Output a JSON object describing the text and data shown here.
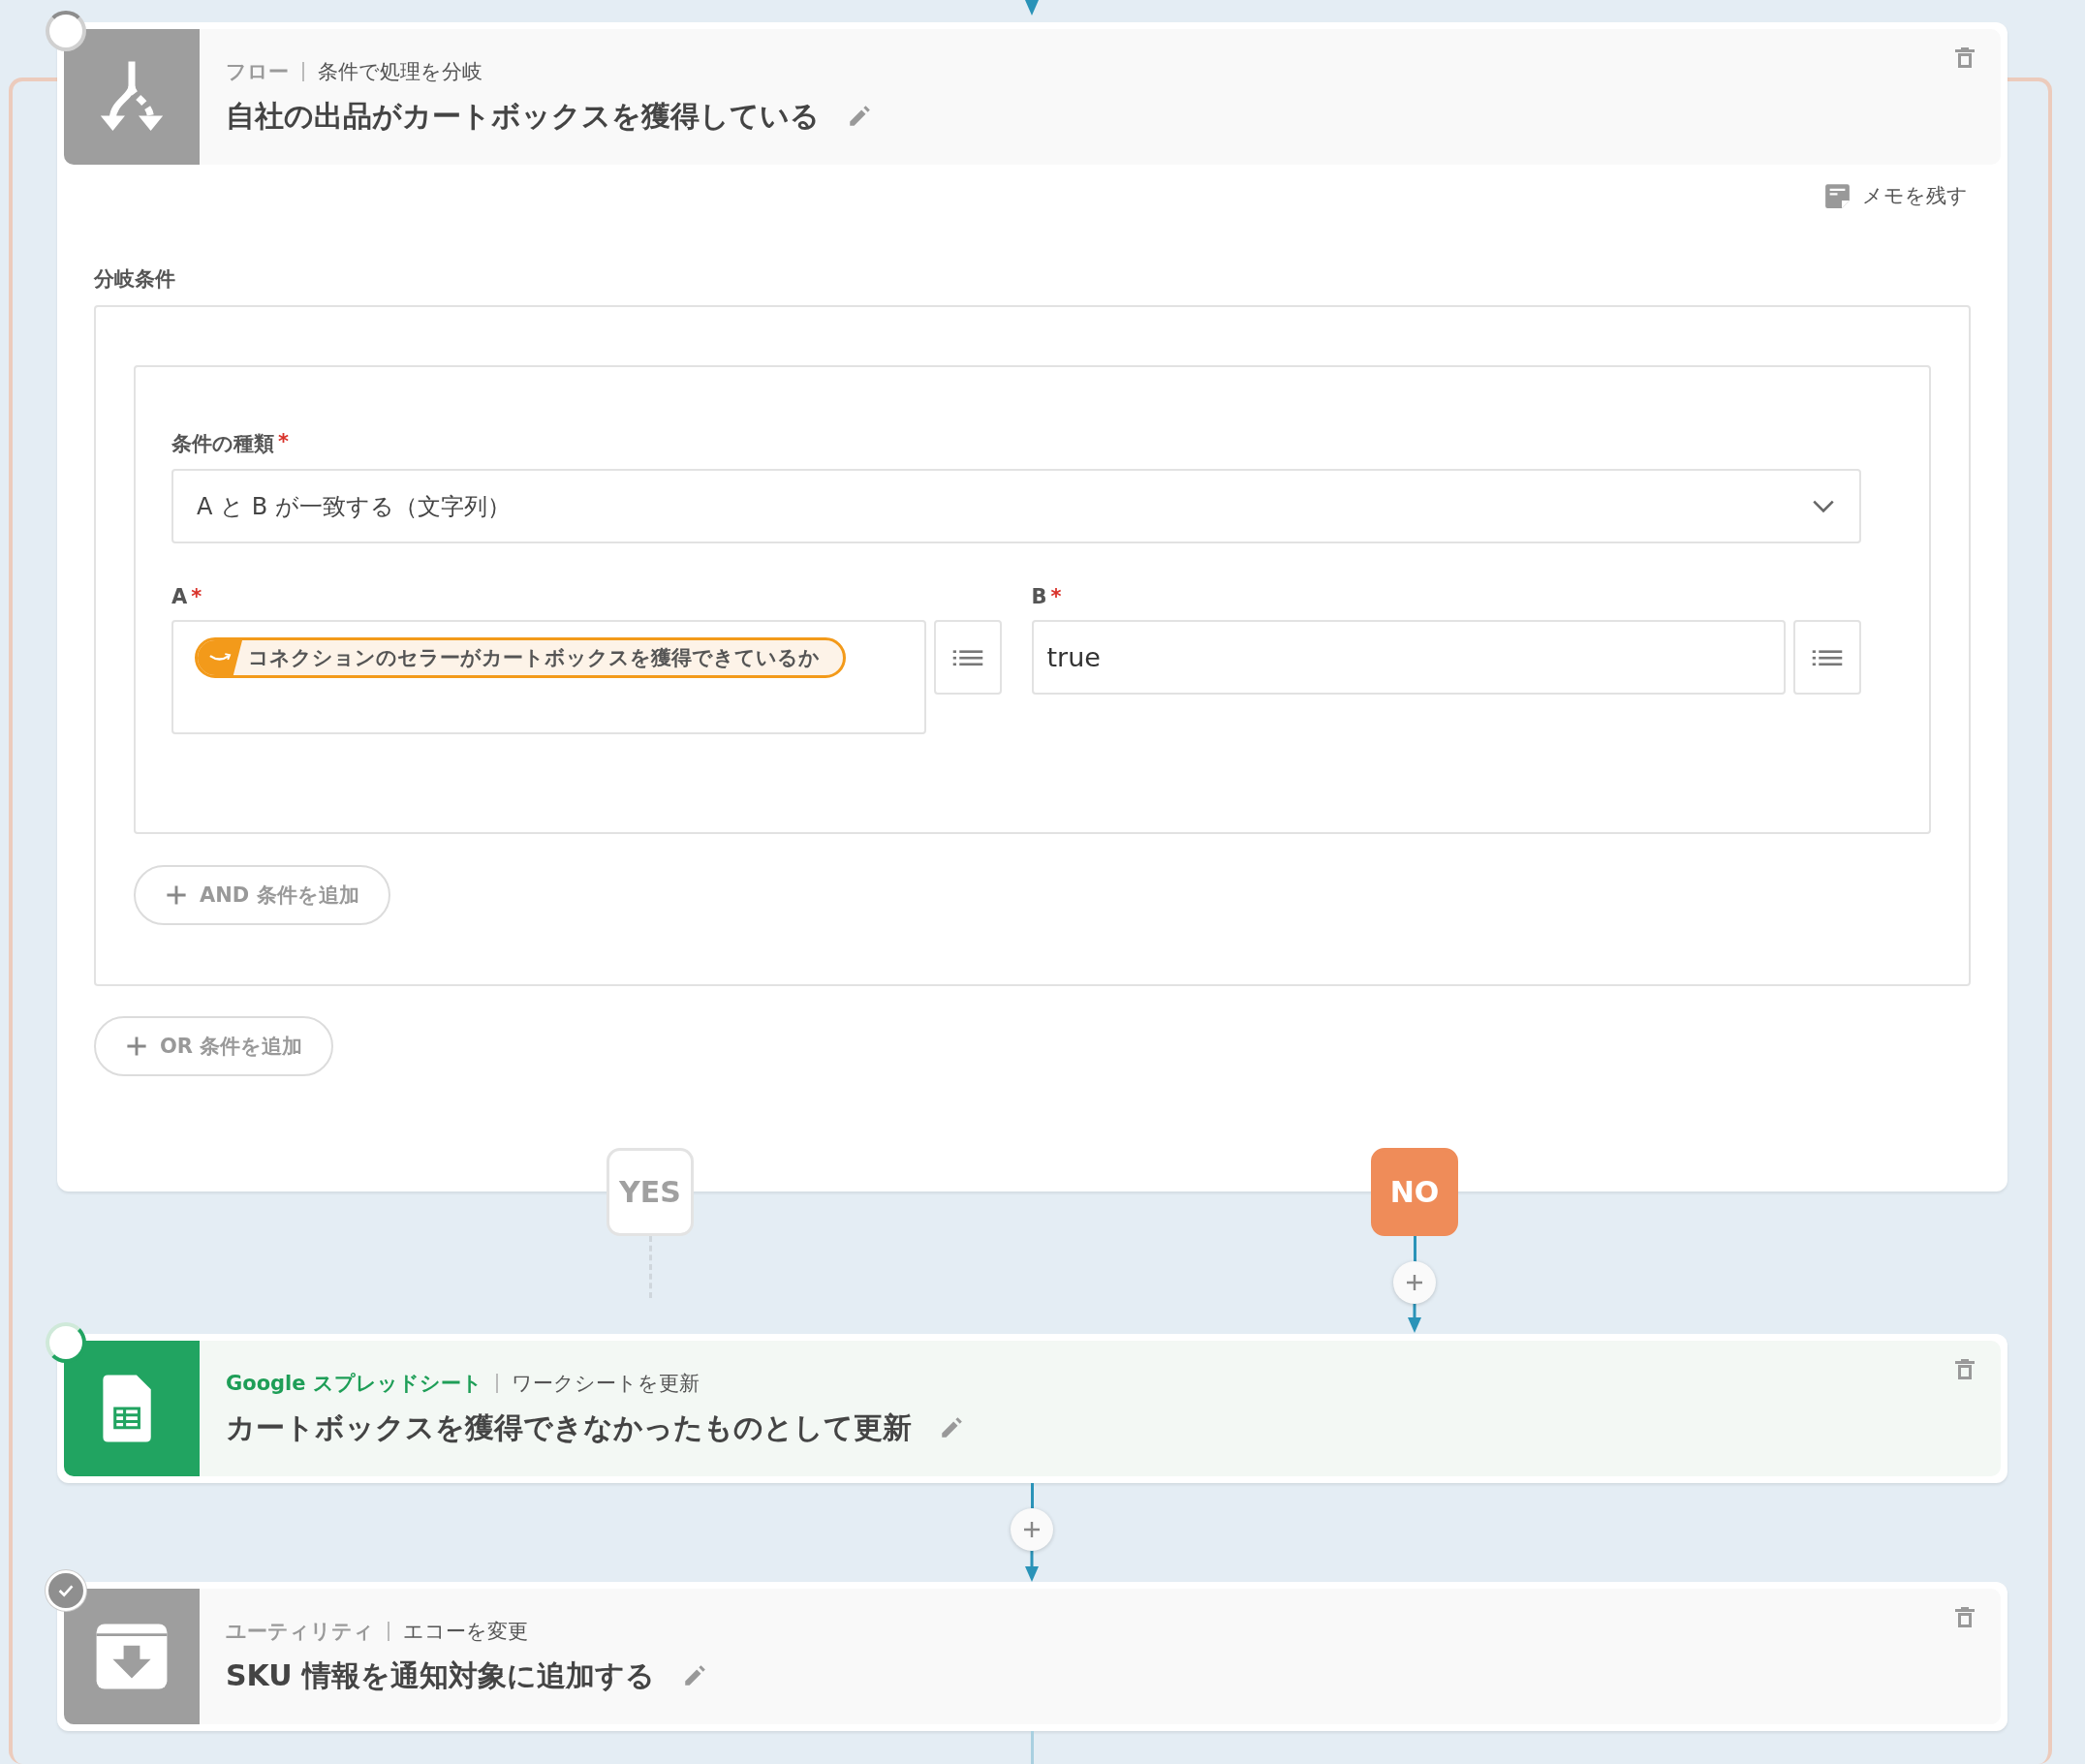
{
  "flow": {
    "steps": [
      {
        "kind": "branch",
        "completed": false,
        "category": "フロー",
        "action": "条件で処理を分岐",
        "title": "自社の出品がカートボックスを獲得している",
        "memo": "メモを残す",
        "section_label": "分岐条件",
        "condition_type": {
          "label": "条件の種類",
          "mark": "*",
          "value": "A と B が一致する（文字列）"
        },
        "operands": [
          {
            "label": "A",
            "mark": "*",
            "kind": "token",
            "value": "コネクションのセラーがカートボックスを獲得できているか"
          },
          {
            "label": "B",
            "mark": "*",
            "kind": "text",
            "value": "true"
          }
        ],
        "and_button": "AND 条件を追加",
        "or_button": "OR 条件を追加",
        "branches": [
          {
            "label": "YES",
            "selected": false
          },
          {
            "label": "NO",
            "selected": true
          }
        ]
      },
      {
        "kind": "sheets",
        "completed": false,
        "category": "Google スプレッドシート",
        "action": "ワークシートを更新",
        "title": "カートボックスを獲得できなかったものとして更新"
      },
      {
        "kind": "utility",
        "completed": true,
        "category": "ユーティリティ",
        "action": "エコーを変更",
        "title": "SKU 情報を通知対象に追加する"
      }
    ]
  }
}
